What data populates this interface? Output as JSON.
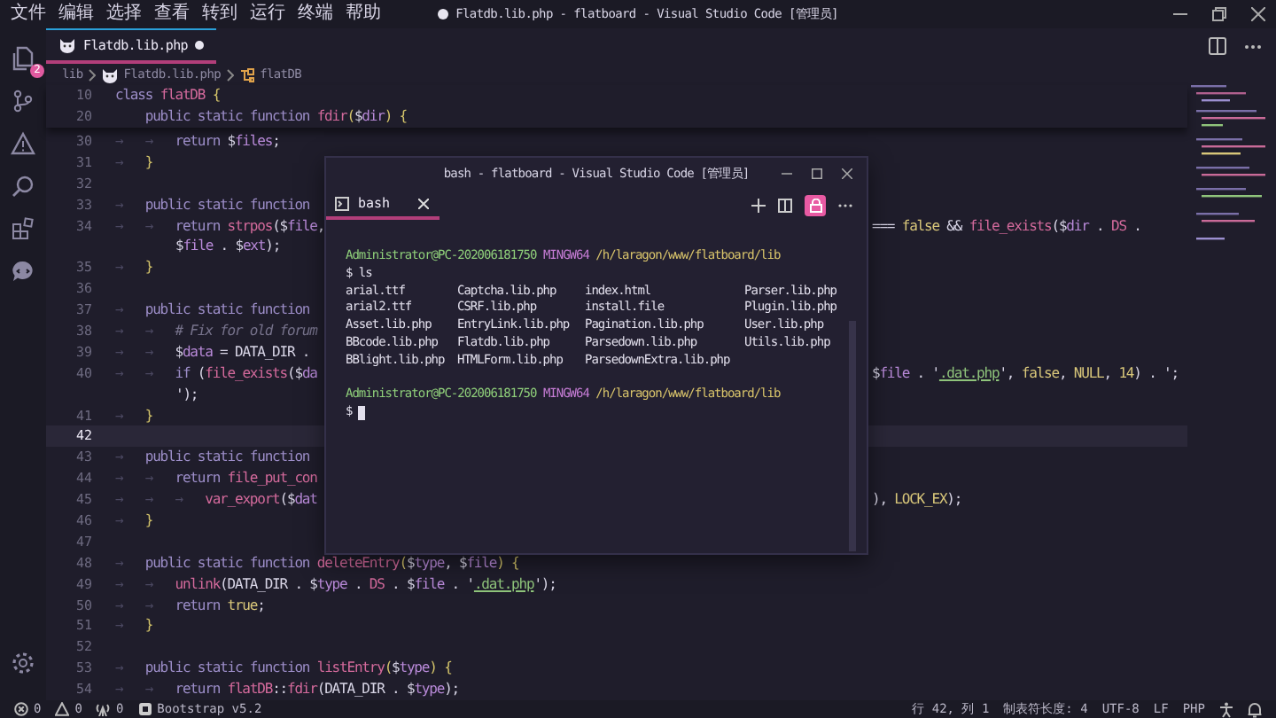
{
  "menu": [
    "文件",
    "编辑",
    "选择",
    "查看",
    "转到",
    "运行",
    "终端",
    "帮助"
  ],
  "title": {
    "text": "Flatdb.lib.php - flatboard - Visual Studio Code [管理员]",
    "modified": true
  },
  "activity_bar": [
    {
      "kind": "files",
      "badge": "2"
    },
    {
      "kind": "source-control"
    },
    {
      "kind": "problems"
    },
    {
      "kind": "search"
    },
    {
      "kind": "extensions"
    },
    {
      "kind": "chat"
    }
  ],
  "tab": {
    "label": "Flatdb.lib.php",
    "modified": true,
    "selected": true
  },
  "breadcrumb": [
    {
      "kind": "folder",
      "label": "lib"
    },
    {
      "kind": "file",
      "label": "Flatdb.lib.php"
    },
    {
      "kind": "class",
      "label": "flatDB"
    }
  ],
  "sticky_lines": [
    {
      "number": "10",
      "tokens": [
        {
          "t": "class ",
          "kind": "kw"
        },
        {
          "t": "flatDB ",
          "kind": "fn"
        },
        {
          "t": "{",
          "kind": "punc"
        }
      ]
    },
    {
      "number": "20",
      "tokens": [
        {
          "t": "    public static function ",
          "kind": "kw"
        },
        {
          "t": "fdir",
          "kind": "fn"
        },
        {
          "t": "(",
          "kind": "punc"
        },
        {
          "t": "$",
          "kind": "op"
        },
        {
          "t": "dir",
          "kind": "var"
        },
        {
          "t": ") ",
          "kind": "punc"
        },
        {
          "t": "{",
          "kind": "punc"
        }
      ]
    }
  ],
  "lines": [
    {
      "kind": "line",
      "number": "30",
      "current": false,
      "indent": "→   →   ",
      "tokens": [
        {
          "t": "return ",
          "kind": "kw"
        },
        {
          "t": "$",
          "kind": "op"
        },
        {
          "t": "files",
          "kind": "var"
        },
        {
          "t": ";",
          "kind": "op"
        }
      ]
    },
    {
      "kind": "line",
      "number": "31",
      "current": false,
      "indent": "→   ",
      "tokens": [
        {
          "t": "}",
          "kind": "punc"
        }
      ]
    },
    {
      "kind": "line",
      "number": "32",
      "current": false
    },
    {
      "kind": "line",
      "number": "33",
      "current": false,
      "indent": "→   ",
      "tokens": [
        {
          "t": "public static function",
          "kind": "kw"
        }
      ]
    },
    {
      "kind": "line",
      "number": "34",
      "current": false,
      "indent": "→   →   ",
      "tokens": [
        {
          "t": "return ",
          "kind": "kw"
        },
        {
          "t": "strpos",
          "kind": "fn"
        },
        {
          "t": "(",
          "kind": "op"
        },
        {
          "t": "$",
          "kind": "op"
        },
        {
          "t": "file",
          "kind": "var"
        },
        {
          "t": ",",
          "kind": "op"
        }
      ],
      "tail": [
        {
          "t": "=== ",
          "kind": "op"
        },
        {
          "t": "false",
          "kind": "const"
        },
        {
          "t": " && ",
          "kind": "op"
        },
        {
          "t": "file_exists",
          "kind": "fn"
        },
        {
          "t": "(",
          "kind": "op"
        },
        {
          "t": "$",
          "kind": "op"
        },
        {
          "t": "dir",
          "kind": "var"
        },
        {
          "t": " . ",
          "kind": "op"
        },
        {
          "t": "DS",
          "kind": "fn"
        },
        {
          "t": " .",
          "kind": "op"
        }
      ]
    },
    {
      "kind": "wrap",
      "current": false,
      "tokens": [
        {
          "t": "$",
          "kind": "op"
        },
        {
          "t": "file",
          "kind": "var"
        },
        {
          "t": " . $",
          "kind": "op"
        },
        {
          "t": "ext",
          "kind": "var"
        },
        {
          "t": ");",
          "kind": "op"
        }
      ]
    },
    {
      "kind": "line",
      "number": "35",
      "current": false,
      "indent": "→   ",
      "tokens": [
        {
          "t": "}",
          "kind": "punc"
        }
      ]
    },
    {
      "kind": "line",
      "number": "36",
      "current": false
    },
    {
      "kind": "line",
      "number": "37",
      "current": false,
      "indent": "→   ",
      "tokens": [
        {
          "t": "public static function",
          "kind": "kw"
        }
      ]
    },
    {
      "kind": "line",
      "number": "38",
      "current": false,
      "indent": "→   →   ",
      "tokens": [
        {
          "t": "# Fix for old forum",
          "kind": "cm"
        }
      ]
    },
    {
      "kind": "line",
      "number": "39",
      "current": false,
      "indent": "→   →   ",
      "tokens": [
        {
          "t": "$",
          "kind": "op"
        },
        {
          "t": "data",
          "kind": "var"
        },
        {
          "t": " = DATA_DIR .",
          "kind": "op"
        }
      ]
    },
    {
      "kind": "line",
      "number": "40",
      "current": false,
      "indent": "→   →   ",
      "tokens": [
        {
          "t": "if ",
          "kind": "kw"
        },
        {
          "t": "(",
          "kind": "op"
        },
        {
          "t": "file_exists",
          "kind": "fn"
        },
        {
          "t": "(",
          "kind": "op"
        },
        {
          "t": "$",
          "kind": "op"
        },
        {
          "t": "da",
          "kind": "var"
        }
      ],
      "tail": [
        {
          "t": "$",
          "kind": "op"
        },
        {
          "t": "file",
          "kind": "var"
        },
        {
          "t": " . '",
          "kind": "op"
        },
        {
          "t": ".dat.php",
          "kind": "str"
        },
        {
          "t": "', ",
          "kind": "op"
        },
        {
          "t": "false",
          "kind": "const"
        },
        {
          "t": ", ",
          "kind": "op"
        },
        {
          "t": "NULL",
          "kind": "const"
        },
        {
          "t": ", ",
          "kind": "op"
        },
        {
          "t": "14",
          "kind": "const"
        },
        {
          "t": ") . ';",
          "kind": "op"
        }
      ]
    },
    {
      "kind": "wrap",
      "current": false,
      "tokens": [
        {
          "t": "');",
          "kind": "op"
        }
      ]
    },
    {
      "kind": "line",
      "number": "41",
      "current": false,
      "indent": "→   ",
      "tokens": [
        {
          "t": "}",
          "kind": "punc"
        }
      ]
    },
    {
      "kind": "line",
      "number": "42",
      "current": true
    },
    {
      "kind": "line",
      "number": "43",
      "current": false,
      "indent": "→   ",
      "tokens": [
        {
          "t": "public static function",
          "kind": "kw"
        }
      ]
    },
    {
      "kind": "line",
      "number": "44",
      "current": false,
      "indent": "→   →   ",
      "tokens": [
        {
          "t": "return ",
          "kind": "kw"
        },
        {
          "t": "file_put_con",
          "kind": "fn"
        }
      ]
    },
    {
      "kind": "line",
      "number": "45",
      "current": false,
      "indent": "→   →   →   ",
      "tokens": [
        {
          "t": "var_export",
          "kind": "fn"
        },
        {
          "t": "(",
          "kind": "op"
        },
        {
          "t": "$",
          "kind": "op"
        },
        {
          "t": "dat",
          "kind": "var"
        }
      ],
      "tail": [
        {
          "t": "), ",
          "kind": "op"
        },
        {
          "t": "LOCK_EX",
          "kind": "const"
        },
        {
          "t": ");",
          "kind": "op"
        }
      ]
    },
    {
      "kind": "line",
      "number": "46",
      "current": false,
      "indent": "→   ",
      "tokens": [
        {
          "t": "}",
          "kind": "punc"
        }
      ]
    },
    {
      "kind": "line",
      "number": "47",
      "current": false
    },
    {
      "kind": "line",
      "number": "48",
      "current": false,
      "indent": "→   ",
      "tokens": [
        {
          "t": "public static function ",
          "kind": "kw"
        },
        {
          "t": "deleteEntry",
          "kind": "fn"
        },
        {
          "t": "(",
          "kind": "punc"
        },
        {
          "t": "$",
          "kind": "op"
        },
        {
          "t": "type",
          "kind": "var"
        },
        {
          "t": ", ",
          "kind": "op"
        },
        {
          "t": "$",
          "kind": "op"
        },
        {
          "t": "file",
          "kind": "var"
        },
        {
          "t": ") ",
          "kind": "punc"
        },
        {
          "t": "{",
          "kind": "punc"
        }
      ]
    },
    {
      "kind": "line",
      "number": "49",
      "current": false,
      "indent": "→   →   ",
      "tokens": [
        {
          "t": "unlink",
          "kind": "fn"
        },
        {
          "t": "(DATA_DIR . $",
          "kind": "op"
        },
        {
          "t": "type",
          "kind": "var"
        },
        {
          "t": " . ",
          "kind": "op"
        },
        {
          "t": "DS",
          "kind": "fn"
        },
        {
          "t": " . $",
          "kind": "op"
        },
        {
          "t": "file",
          "kind": "var"
        },
        {
          "t": " . '",
          "kind": "op"
        },
        {
          "t": ".dat.php",
          "kind": "str"
        },
        {
          "t": "');",
          "kind": "op"
        }
      ]
    },
    {
      "kind": "line",
      "number": "50",
      "current": false,
      "indent": "→   →   ",
      "tokens": [
        {
          "t": "return ",
          "kind": "kw"
        },
        {
          "t": "true",
          "kind": "const"
        },
        {
          "t": ";",
          "kind": "op"
        }
      ]
    },
    {
      "kind": "line",
      "number": "51",
      "current": false,
      "indent": "→   ",
      "tokens": [
        {
          "t": "}",
          "kind": "punc"
        }
      ]
    },
    {
      "kind": "line",
      "number": "52",
      "current": false
    },
    {
      "kind": "line",
      "number": "53",
      "current": false,
      "indent": "→   ",
      "tokens": [
        {
          "t": "public static function ",
          "kind": "kw"
        },
        {
          "t": "listEntry",
          "kind": "fn"
        },
        {
          "t": "(",
          "kind": "punc"
        },
        {
          "t": "$",
          "kind": "op"
        },
        {
          "t": "type",
          "kind": "var"
        },
        {
          "t": ") ",
          "kind": "punc"
        },
        {
          "t": "{",
          "kind": "punc"
        }
      ]
    },
    {
      "kind": "line",
      "number": "54",
      "current": false,
      "indent": "→   →   ",
      "tokens": [
        {
          "t": "return ",
          "kind": "kw"
        },
        {
          "t": "flatDB",
          "kind": "fn"
        },
        {
          "t": "::",
          "kind": "op"
        },
        {
          "t": "fdir",
          "kind": "fn"
        },
        {
          "t": "(DATA_DIR . $",
          "kind": "op"
        },
        {
          "t": "type",
          "kind": "var"
        },
        {
          "t": ");",
          "kind": "op"
        }
      ]
    }
  ],
  "terminal": {
    "title": "bash - flatboard - Visual Studio Code [管理员]",
    "tab": {
      "label": "bash",
      "selected": true
    },
    "lines": [
      {
        "kind": "prompt",
        "user": "Administrator@PC-202006181750",
        "system": "MINGW64",
        "path": "/h/laragon/www/flatboard/lib"
      },
      {
        "kind": "command",
        "text": "$ ls"
      },
      {
        "kind": "listing",
        "columns": [
          [
            "arial.ttf",
            "arial2.ttf",
            "Asset.lib.php",
            "BBcode.lib.php",
            "BBlight.lib.php"
          ],
          [
            "Captcha.lib.php",
            "CSRF.lib.php",
            "EntryLink.lib.php",
            "Flatdb.lib.php",
            "HTMLForm.lib.php"
          ],
          [
            "index.html",
            "install.file",
            "Pagination.lib.php",
            "Parsedown.lib.php",
            "ParsedownExtra.lib.php"
          ],
          [
            "Parser.lib.php",
            "Plugin.lib.php",
            "User.lib.php",
            "Utils.lib.php"
          ]
        ]
      },
      {
        "kind": "prompt",
        "user": "Administrator@PC-202006181750",
        "system": "MINGW64",
        "path": "/h/laragon/www/flatboard/lib"
      },
      {
        "kind": "cursor",
        "text": "$"
      }
    ]
  },
  "status_bar": {
    "left": [
      {
        "kind": "errors",
        "text": "0"
      },
      {
        "kind": "warnings",
        "text": "0"
      },
      {
        "kind": "ports",
        "text": "0"
      },
      {
        "kind": "extension",
        "text": "Bootstrap v5.2"
      }
    ],
    "right": [
      {
        "kind": "text",
        "text": "行 42, 列 1"
      },
      {
        "kind": "text",
        "text": "制表符长度: 4"
      },
      {
        "kind": "text",
        "text": "UTF-8"
      },
      {
        "kind": "text",
        "text": "LF"
      },
      {
        "kind": "text",
        "text": "PHP"
      },
      {
        "kind": "accessibility"
      },
      {
        "kind": "bell"
      }
    ]
  }
}
